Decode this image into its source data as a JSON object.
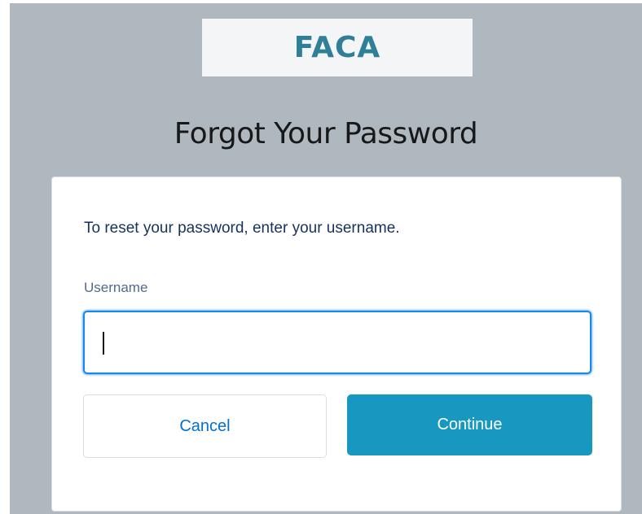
{
  "logo": {
    "text": "FACA",
    "color": "#2f7f99"
  },
  "page_title": "Forgot Your Password",
  "form": {
    "instructions": "To reset your password, enter your username.",
    "username_label": "Username",
    "username_value": "",
    "cancel_label": "Cancel",
    "continue_label": "Continue"
  },
  "colors": {
    "background": "#b0b8bf",
    "primary_button": "#1798c1",
    "link": "#0070d2",
    "input_focus_border": "#1589ee"
  }
}
